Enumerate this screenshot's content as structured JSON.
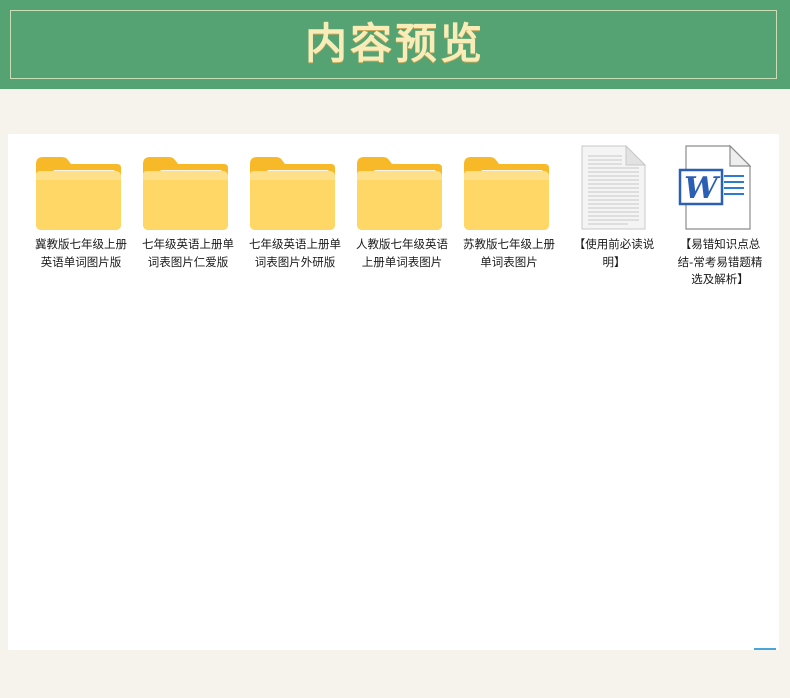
{
  "header": {
    "title": "内容预览"
  },
  "colors": {
    "banner_bg": "#55a372",
    "title_gold": "#f8edb8",
    "page_bg": "#f6f3ed",
    "folder_yellow": "#ffd766",
    "word_blue": "#2b5fb4"
  },
  "files": [
    {
      "name": "冀教版七年级上册英语单词图片版",
      "icon": "folder-icon"
    },
    {
      "name": "七年级英语上册单词表图片仁爱版",
      "icon": "folder-icon"
    },
    {
      "name": "七年级英语上册单词表图片外研版",
      "icon": "folder-icon"
    },
    {
      "name": "人教版七年级英语上册单词表图片",
      "icon": "folder-icon"
    },
    {
      "name": "苏教版七年级上册单词表图片",
      "icon": "folder-icon"
    },
    {
      "name": "【使用前必读说明】",
      "icon": "text-document-icon"
    },
    {
      "name": "【易错知识点总结-常考易错题精选及解析】",
      "icon": "word-document-icon"
    }
  ]
}
